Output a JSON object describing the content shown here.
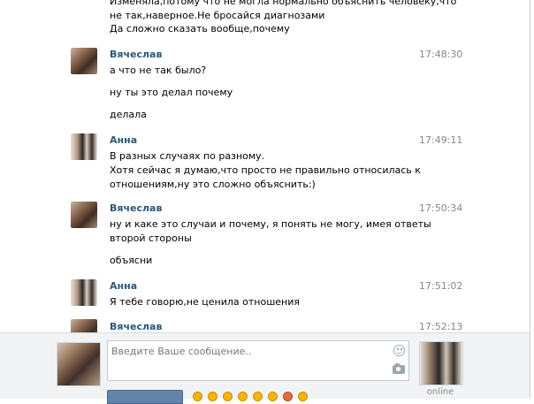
{
  "messages": [
    {
      "kind": "text",
      "text": "Изменяла,потому что не могла нормально объяснить человеку,что"
    },
    {
      "kind": "text",
      "text": "не так,наверное.Не бросайся диагнозами"
    },
    {
      "kind": "text",
      "text": "Да сложно сказать вообще,почему"
    },
    {
      "kind": "group",
      "author": "Вячеслав",
      "time": "17:48:30",
      "lines": [
        "а что не так было?",
        "ну ты это делал почему",
        "делала"
      ]
    },
    {
      "kind": "group",
      "author": "Анна",
      "time": "17:49:11",
      "lines": [
        "В разных случаях по разному.",
        "Хотя сейчас я думаю,что просто не правильно относилась к",
        "отношениям,ну это сложно объяснить:)"
      ]
    },
    {
      "kind": "group",
      "author": "Вячеслав",
      "time": "17:50:34",
      "lines": [
        "ну и каке это случаи и почему, я понять не могу, имея ответы",
        "второй стороны",
        "объясни"
      ]
    },
    {
      "kind": "group",
      "author": "Анна",
      "time": "17:51:02",
      "lines": [
        "Я тебе говорю,не ценила отношения"
      ]
    },
    {
      "kind": "group",
      "author": "Вячеслав",
      "time": "17:52:13",
      "lines": []
    }
  ],
  "compose": {
    "placeholder": "Введите Ваше сообщение..",
    "peer_status": "online"
  },
  "icons": {
    "smile": "smile-icon",
    "camera": "camera-icon"
  },
  "colors": {
    "author": "#2b587a",
    "button": "#6383a8",
    "compose_bg": "#f1f3f5"
  }
}
